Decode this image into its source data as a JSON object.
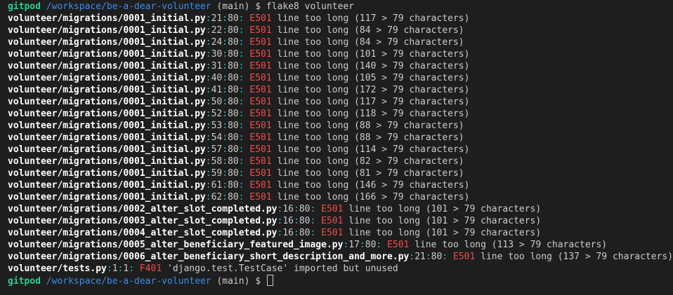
{
  "prompt": {
    "user": "gitpod",
    "path": "/workspace/be-a-dear-volunteer",
    "branch": "(main)",
    "symbol": "$",
    "command": "flake8 volunteer"
  },
  "errors": [
    {
      "file": "volunteer/migrations/0001_initial.py",
      "line": "21",
      "col": "80",
      "code": "E501",
      "message": "line too long (117 > 79 characters)"
    },
    {
      "file": "volunteer/migrations/0001_initial.py",
      "line": "22",
      "col": "80",
      "code": "E501",
      "message": "line too long (84 > 79 characters)"
    },
    {
      "file": "volunteer/migrations/0001_initial.py",
      "line": "24",
      "col": "80",
      "code": "E501",
      "message": "line too long (84 > 79 characters)"
    },
    {
      "file": "volunteer/migrations/0001_initial.py",
      "line": "30",
      "col": "80",
      "code": "E501",
      "message": "line too long (101 > 79 characters)"
    },
    {
      "file": "volunteer/migrations/0001_initial.py",
      "line": "31",
      "col": "80",
      "code": "E501",
      "message": "line too long (140 > 79 characters)"
    },
    {
      "file": "volunteer/migrations/0001_initial.py",
      "line": "40",
      "col": "80",
      "code": "E501",
      "message": "line too long (105 > 79 characters)"
    },
    {
      "file": "volunteer/migrations/0001_initial.py",
      "line": "41",
      "col": "80",
      "code": "E501",
      "message": "line too long (172 > 79 characters)"
    },
    {
      "file": "volunteer/migrations/0001_initial.py",
      "line": "50",
      "col": "80",
      "code": "E501",
      "message": "line too long (117 > 79 characters)"
    },
    {
      "file": "volunteer/migrations/0001_initial.py",
      "line": "52",
      "col": "80",
      "code": "E501",
      "message": "line too long (118 > 79 characters)"
    },
    {
      "file": "volunteer/migrations/0001_initial.py",
      "line": "53",
      "col": "80",
      "code": "E501",
      "message": "line too long (88 > 79 characters)"
    },
    {
      "file": "volunteer/migrations/0001_initial.py",
      "line": "54",
      "col": "80",
      "code": "E501",
      "message": "line too long (88 > 79 characters)"
    },
    {
      "file": "volunteer/migrations/0001_initial.py",
      "line": "57",
      "col": "80",
      "code": "E501",
      "message": "line too long (114 > 79 characters)"
    },
    {
      "file": "volunteer/migrations/0001_initial.py",
      "line": "58",
      "col": "80",
      "code": "E501",
      "message": "line too long (82 > 79 characters)"
    },
    {
      "file": "volunteer/migrations/0001_initial.py",
      "line": "59",
      "col": "80",
      "code": "E501",
      "message": "line too long (81 > 79 characters)"
    },
    {
      "file": "volunteer/migrations/0001_initial.py",
      "line": "61",
      "col": "80",
      "code": "E501",
      "message": "line too long (146 > 79 characters)"
    },
    {
      "file": "volunteer/migrations/0001_initial.py",
      "line": "62",
      "col": "80",
      "code": "E501",
      "message": "line too long (166 > 79 characters)"
    },
    {
      "file": "volunteer/migrations/0002_alter_slot_completed.py",
      "line": "16",
      "col": "80",
      "code": "E501",
      "message": "line too long (101 > 79 characters)"
    },
    {
      "file": "volunteer/migrations/0003_alter_slot_completed.py",
      "line": "16",
      "col": "80",
      "code": "E501",
      "message": "line too long (101 > 79 characters)"
    },
    {
      "file": "volunteer/migrations/0004_alter_slot_completed.py",
      "line": "16",
      "col": "80",
      "code": "E501",
      "message": "line too long (101 > 79 characters)"
    },
    {
      "file": "volunteer/migrations/0005_alter_beneficiary_featured_image.py",
      "line": "17",
      "col": "80",
      "code": "E501",
      "message": "line too long (113 > 79 characters)"
    },
    {
      "file": "volunteer/migrations/0006_alter_beneficiary_short_description_and_more.py",
      "line": "21",
      "col": "80",
      "code": "E501",
      "message": "line too long (137 > 79 characters)"
    },
    {
      "file": "volunteer/tests.py",
      "line": "1",
      "col": "1",
      "code": "F401",
      "message": "'django.test.TestCase' imported but unused"
    }
  ],
  "colors": {
    "background": "#1e1e1e",
    "user": "#23d18b",
    "path": "#3b8eea",
    "separator": "#29b8db",
    "error_code": "#f14c4c",
    "text": "#cccccc"
  }
}
